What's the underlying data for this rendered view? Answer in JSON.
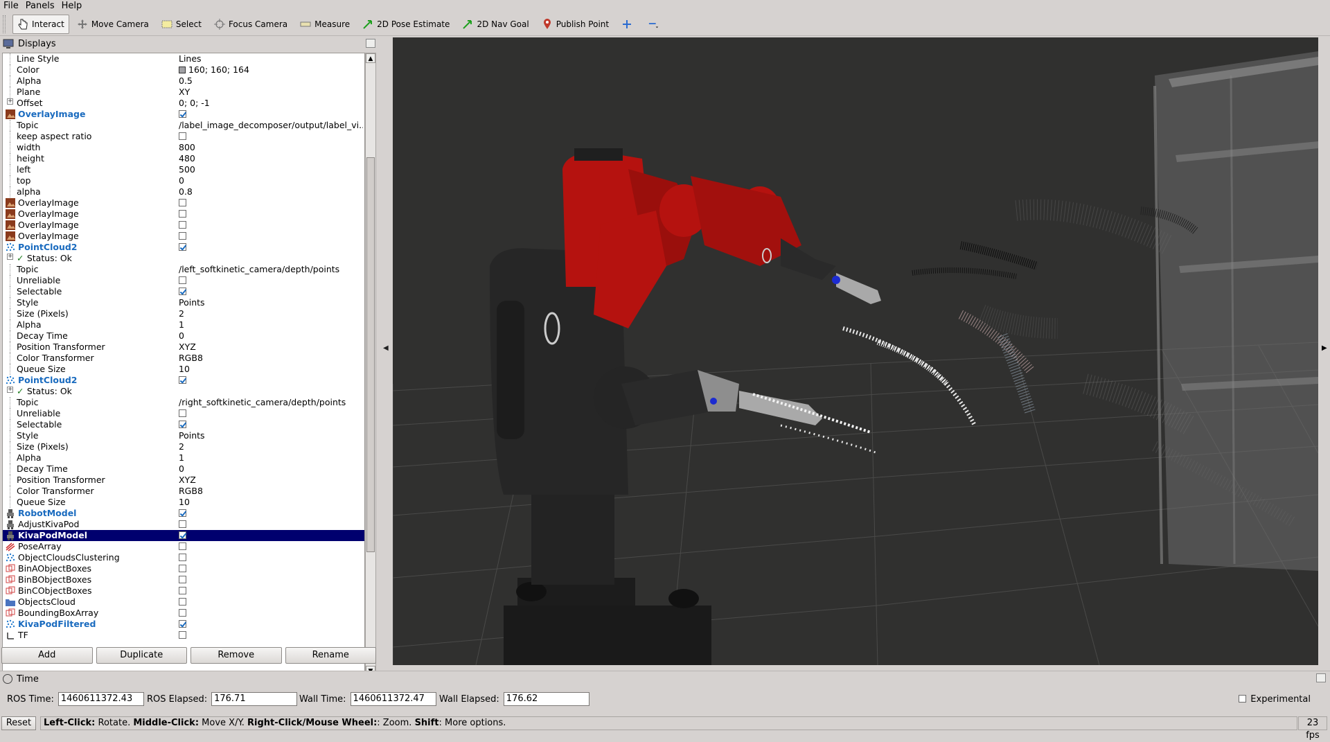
{
  "menu": {
    "file": "File",
    "panels": "Panels",
    "help": "Help"
  },
  "toolbar": {
    "interact": "Interact",
    "move_camera": "Move Camera",
    "select": "Select",
    "focus_camera": "Focus Camera",
    "measure": "Measure",
    "pose_estimate": "2D Pose Estimate",
    "nav_goal": "2D Nav Goal",
    "publish_point": "Publish Point"
  },
  "displays": {
    "title": "Displays",
    "rows": [
      {
        "name": "Line Style",
        "value": "Lines",
        "depth": 2
      },
      {
        "name": "Color",
        "value": "160; 160; 164",
        "depth": 2,
        "swatch": true
      },
      {
        "name": "Alpha",
        "value": "0.5",
        "depth": 2
      },
      {
        "name": "Plane",
        "value": "XY",
        "depth": 2
      },
      {
        "name": "Offset",
        "value": "0; 0; -1",
        "depth": 2,
        "expander": true
      },
      {
        "name": "OverlayImage",
        "value": "",
        "depth": 1,
        "display": true,
        "enabled": true,
        "check": true,
        "icon": "image-icon"
      },
      {
        "name": "Topic",
        "value": "/label_image_decomposer/output/label_vi...",
        "depth": 2
      },
      {
        "name": "keep aspect ratio",
        "value": "",
        "depth": 2,
        "check": false
      },
      {
        "name": "width",
        "value": "800",
        "depth": 2
      },
      {
        "name": "height",
        "value": "480",
        "depth": 2
      },
      {
        "name": "left",
        "value": "500",
        "depth": 2
      },
      {
        "name": "top",
        "value": "0",
        "depth": 2
      },
      {
        "name": "alpha",
        "value": "0.8",
        "depth": 2
      },
      {
        "name": "OverlayImage",
        "value": "",
        "depth": 1,
        "display": true,
        "check": false,
        "icon": "image-icon"
      },
      {
        "name": "OverlayImage",
        "value": "",
        "depth": 1,
        "display": true,
        "check": false,
        "icon": "image-icon"
      },
      {
        "name": "OverlayImage",
        "value": "",
        "depth": 1,
        "display": true,
        "check": false,
        "icon": "image-icon"
      },
      {
        "name": "OverlayImage",
        "value": "",
        "depth": 1,
        "display": true,
        "check": false,
        "icon": "image-icon"
      },
      {
        "name": "PointCloud2",
        "value": "",
        "depth": 1,
        "display": true,
        "enabled": true,
        "check": true,
        "icon": "pointcloud-icon"
      },
      {
        "name": "Status: Ok",
        "value": "",
        "depth": 2,
        "expander": true,
        "status": true
      },
      {
        "name": "Topic",
        "value": "/left_softkinetic_camera/depth/points",
        "depth": 2
      },
      {
        "name": "Unreliable",
        "value": "",
        "depth": 2,
        "check": false
      },
      {
        "name": "Selectable",
        "value": "",
        "depth": 2,
        "check": true
      },
      {
        "name": "Style",
        "value": "Points",
        "depth": 2
      },
      {
        "name": "Size (Pixels)",
        "value": "2",
        "depth": 2
      },
      {
        "name": "Alpha",
        "value": "1",
        "depth": 2
      },
      {
        "name": "Decay Time",
        "value": "0",
        "depth": 2
      },
      {
        "name": "Position Transformer",
        "value": "XYZ",
        "depth": 2
      },
      {
        "name": "Color Transformer",
        "value": "RGB8",
        "depth": 2
      },
      {
        "name": "Queue Size",
        "value": "10",
        "depth": 2
      },
      {
        "name": "PointCloud2",
        "value": "",
        "depth": 1,
        "display": true,
        "enabled": true,
        "check": true,
        "icon": "pointcloud-icon"
      },
      {
        "name": "Status: Ok",
        "value": "",
        "depth": 2,
        "expander": true,
        "status": true
      },
      {
        "name": "Topic",
        "value": "/right_softkinetic_camera/depth/points",
        "depth": 2
      },
      {
        "name": "Unreliable",
        "value": "",
        "depth": 2,
        "check": false
      },
      {
        "name": "Selectable",
        "value": "",
        "depth": 2,
        "check": true
      },
      {
        "name": "Style",
        "value": "Points",
        "depth": 2
      },
      {
        "name": "Size (Pixels)",
        "value": "2",
        "depth": 2
      },
      {
        "name": "Alpha",
        "value": "1",
        "depth": 2
      },
      {
        "name": "Decay Time",
        "value": "0",
        "depth": 2
      },
      {
        "name": "Position Transformer",
        "value": "XYZ",
        "depth": 2
      },
      {
        "name": "Color Transformer",
        "value": "RGB8",
        "depth": 2
      },
      {
        "name": "Queue Size",
        "value": "10",
        "depth": 2
      },
      {
        "name": "RobotModel",
        "value": "",
        "depth": 1,
        "display": true,
        "enabled": true,
        "check": true,
        "icon": "robot-icon"
      },
      {
        "name": "AdjustKivaPod",
        "value": "",
        "depth": 1,
        "display": true,
        "check": false,
        "icon": "robot-icon"
      },
      {
        "name": "KivaPodModel",
        "value": "",
        "depth": 1,
        "display": true,
        "enabled": true,
        "check": true,
        "selected": true,
        "icon": "robot-icon"
      },
      {
        "name": "PoseArray",
        "value": "",
        "depth": 1,
        "display": true,
        "check": false,
        "icon": "posearray-icon"
      },
      {
        "name": "ObjectCloudsClustering",
        "value": "",
        "depth": 1,
        "display": true,
        "check": false,
        "icon": "pointcloud-icon"
      },
      {
        "name": "BinAObjectBoxes",
        "value": "",
        "depth": 1,
        "display": true,
        "check": false,
        "icon": "boxes-icon"
      },
      {
        "name": "BinBObjectBoxes",
        "value": "",
        "depth": 1,
        "display": true,
        "check": false,
        "icon": "boxes-icon"
      },
      {
        "name": "BinCObjectBoxes",
        "value": "",
        "depth": 1,
        "display": true,
        "check": false,
        "icon": "boxes-icon"
      },
      {
        "name": "ObjectsCloud",
        "value": "",
        "depth": 1,
        "display": true,
        "check": false,
        "icon": "folder-icon"
      },
      {
        "name": "BoundingBoxArray",
        "value": "",
        "depth": 1,
        "display": true,
        "check": false,
        "icon": "boxes-icon"
      },
      {
        "name": "KivaPodFiltered",
        "value": "",
        "depth": 1,
        "display": true,
        "enabled": true,
        "check": true,
        "icon": "pointcloud-icon"
      },
      {
        "name": "TF",
        "value": "",
        "depth": 1,
        "display": true,
        "check": false,
        "icon": "tf-icon"
      }
    ],
    "buttons": {
      "add": "Add",
      "duplicate": "Duplicate",
      "remove": "Remove",
      "rename": "Rename"
    }
  },
  "time": {
    "title": "Time",
    "ros_time_label": "ROS Time:",
    "ros_time": "1460611372.43",
    "ros_elapsed_label": "ROS Elapsed:",
    "ros_elapsed": "176.71",
    "wall_time_label": "Wall Time:",
    "wall_time": "1460611372.47",
    "wall_elapsed_label": "Wall Elapsed:",
    "wall_elapsed": "176.62",
    "experimental": "Experimental"
  },
  "status": {
    "reset": "Reset",
    "hint_left_b": "Left-Click:",
    "hint_left": " Rotate. ",
    "hint_mid_b": "Middle-Click:",
    "hint_mid": " Move X/Y. ",
    "hint_right_b": "Right-Click/Mouse Wheel:",
    "hint_right": ": Zoom. ",
    "hint_shift_b": "Shift",
    "hint_shift": ": More options.",
    "fps": "23 fps"
  },
  "colors": {
    "accent": "#1a6bbf",
    "selection": "#00006e",
    "robot_red": "#b5120f",
    "viewport_bg": "#30302f"
  }
}
